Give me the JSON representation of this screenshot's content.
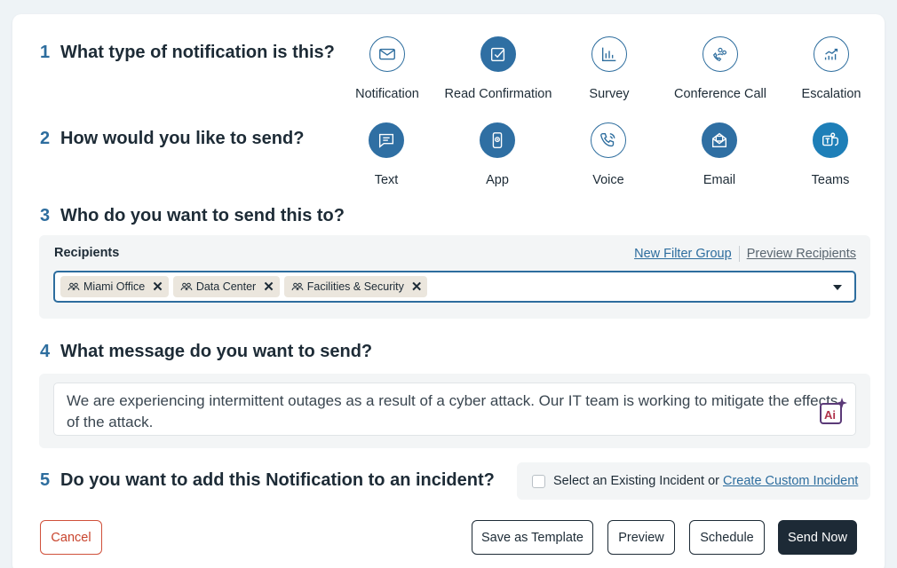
{
  "steps": [
    {
      "num": "1",
      "title": "What type of notification is this?"
    },
    {
      "num": "2",
      "title": "How would you like to send?"
    },
    {
      "num": "3",
      "title": "Who do you want to send this to?"
    },
    {
      "num": "4",
      "title": "What message do you want to send?"
    },
    {
      "num": "5",
      "title": "Do you want to add this Notification to an incident?"
    }
  ],
  "notification_types": [
    {
      "label": "Notification",
      "icon": "envelope-icon",
      "selected": false
    },
    {
      "label": "Read Confirmation",
      "icon": "checkbox-icon",
      "selected": true
    },
    {
      "label": "Survey",
      "icon": "bar-chart-icon",
      "selected": false
    },
    {
      "label": "Conference Call",
      "icon": "group-call-icon",
      "selected": false
    },
    {
      "label": "Escalation",
      "icon": "trend-up-icon",
      "selected": false
    }
  ],
  "channels": [
    {
      "label": "Text",
      "icon": "chat-icon",
      "selected": true
    },
    {
      "label": "App",
      "icon": "mobile-app-icon",
      "selected": true
    },
    {
      "label": "Voice",
      "icon": "phone-icon",
      "selected": false
    },
    {
      "label": "Email",
      "icon": "email-icon",
      "selected": true
    },
    {
      "label": "Teams",
      "icon": "teams-icon",
      "selected": true
    }
  ],
  "recipients": {
    "label": "Recipients",
    "new_filter_group": "New Filter Group",
    "preview_recipients": "Preview Recipients",
    "chips": [
      "Miami Office",
      "Data Center",
      "Facilities & Security"
    ]
  },
  "message": {
    "text": "We are experiencing intermittent outages as a result of a cyber attack. Our IT team is working to mitigate the effects of the attack."
  },
  "incident": {
    "checkbox_label": "Select an Existing Incident or",
    "create_link": "Create Custom Incident"
  },
  "buttons": {
    "cancel": "Cancel",
    "save_template": "Save as Template",
    "preview": "Preview",
    "schedule": "Schedule",
    "send_now": "Send Now"
  },
  "colors": {
    "accent": "#2d6d9e",
    "primary_button": "#1d2a36",
    "cancel": "#c8442d",
    "teams": "#1e7fb8"
  }
}
